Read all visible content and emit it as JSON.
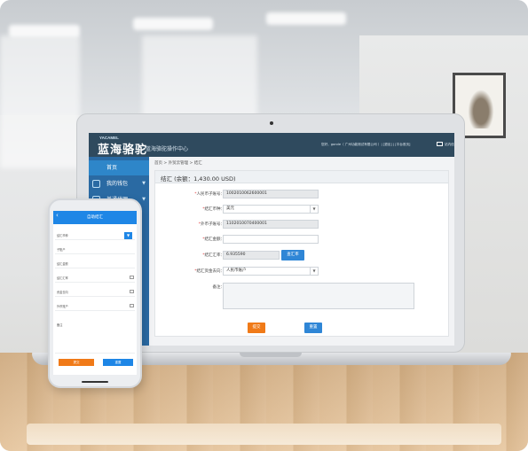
{
  "app": {
    "logo_en": "YACAMEL",
    "logo_cn": "蓝海骆驼",
    "subtitle": "蓝海骆驼操作中心",
    "user_info": "您好，gonde（ 广州功能测试有限公司 ）| [退出] | [平台首页]",
    "mail_label": "站内信"
  },
  "sidebar": {
    "items": [
      {
        "label": "首页",
        "active": true
      },
      {
        "label": "我的钱包",
        "active": false
      },
      {
        "label": "普通代理",
        "active": false
      }
    ]
  },
  "breadcrumb": "首页 > 外贸云管理 > 结汇",
  "form": {
    "title": "结汇 (余额：1,430.00 USD)",
    "fields": [
      {
        "label": "人民币子账号：",
        "required": true,
        "value": "1002010062600001",
        "readonly": true
      },
      {
        "label": "结汇币种：",
        "required": true,
        "value": "美元",
        "select": true
      },
      {
        "label": "外币子账号：",
        "required": true,
        "value": "1102010070400001",
        "readonly": true
      },
      {
        "label": "结汇金额：",
        "required": true,
        "value": ""
      },
      {
        "label": "结汇汇率：",
        "required": true,
        "value": "6.935590",
        "readonly": true,
        "button": "查汇率"
      },
      {
        "label": "结汇资金去向：",
        "required": true,
        "value": "人民币账户",
        "select": true
      }
    ],
    "note_label": "备注：",
    "submit_label": "提交",
    "reset_label": "重置"
  },
  "phone": {
    "title": "自助结汇",
    "rows": [
      {
        "label": "结汇币种"
      },
      {
        "label": "子账户"
      },
      {
        "label": "结汇金额"
      },
      {
        "label": "结汇汇率"
      },
      {
        "label": "资金去向"
      },
      {
        "label": "外币账户"
      }
    ],
    "note_label": "备注",
    "submit_label": "提交",
    "reset_label": "重置"
  },
  "colors": {
    "header": "#2f4a5e",
    "sidebar": "#2a6aa3",
    "primary": "#2f86d6",
    "accent": "#f07a18"
  }
}
